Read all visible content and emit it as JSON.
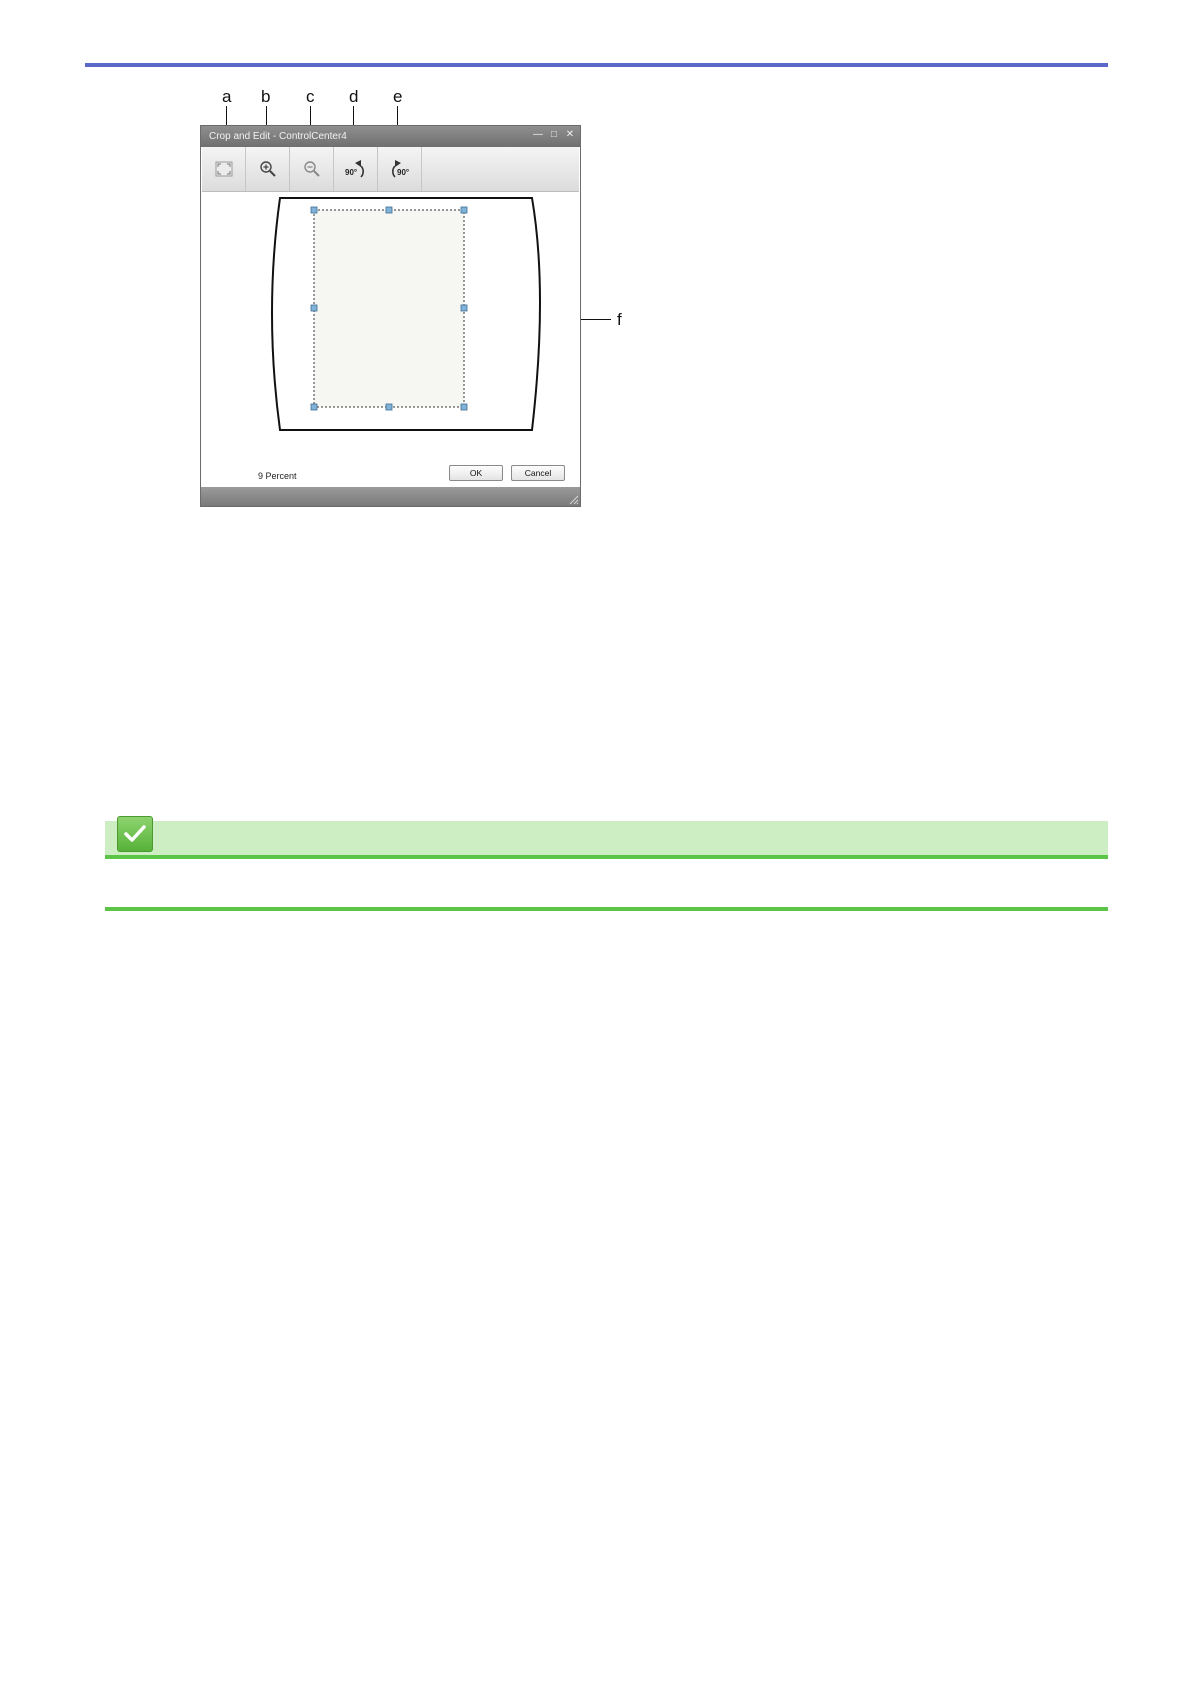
{
  "figure": {
    "callouts": [
      "a",
      "b",
      "c",
      "d",
      "e",
      "f"
    ],
    "dialog": {
      "title": "Crop and Edit - ControlCenter4",
      "window_controls": {
        "minimize": "—",
        "maximize": "□",
        "close": "✕"
      },
      "toolbar": [
        {
          "name": "fit-to-window",
          "icon": "fit-to-window-icon"
        },
        {
          "name": "zoom-in",
          "icon": "zoom-in-icon"
        },
        {
          "name": "zoom-out",
          "icon": "zoom-out-icon"
        },
        {
          "name": "rotate-left",
          "icon": "rotate-left-90-icon",
          "label": "90°"
        },
        {
          "name": "rotate-right",
          "icon": "rotate-right-90-icon",
          "label": "90°"
        }
      ],
      "zoom_status": "9 Percent",
      "ok_label": "OK",
      "cancel_label": "Cancel"
    }
  },
  "note": {
    "icon": "checkmark-icon",
    "colors": {
      "header": "#cdeec3",
      "rule": "#5cc547",
      "top_rule": "#5b67c9"
    }
  }
}
